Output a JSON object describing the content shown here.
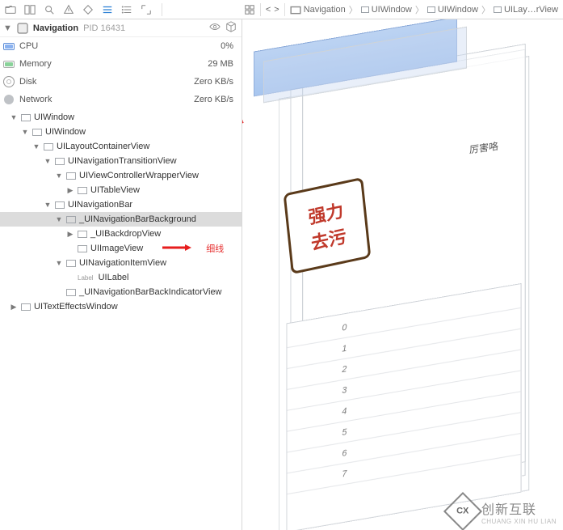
{
  "toolbar": {
    "icons": [
      "folder-icon",
      "panels-icon",
      "search-icon",
      "warning-icon",
      "diamond-icon",
      "align-icon",
      "list-icon",
      "expand-icon"
    ]
  },
  "breadcrumb": {
    "nav_back": "<",
    "nav_fwd": ">",
    "items": [
      "Navigation",
      "UIWindow",
      "UIWindow",
      "UILay…rView"
    ]
  },
  "navHeader": {
    "title": "Navigation",
    "pid_label": "PID 16431"
  },
  "stats": [
    {
      "label": "CPU",
      "value": "0%",
      "icon": "cpu"
    },
    {
      "label": "Memory",
      "value": "29 MB",
      "icon": "mem"
    },
    {
      "label": "Disk",
      "value": "Zero KB/s",
      "icon": "disk"
    },
    {
      "label": "Network",
      "value": "Zero KB/s",
      "icon": "net"
    }
  ],
  "tree": [
    {
      "d": 0,
      "o": true,
      "t": "UIWindow"
    },
    {
      "d": 1,
      "o": true,
      "t": "UIWindow"
    },
    {
      "d": 2,
      "o": true,
      "t": "UILayoutContainerView"
    },
    {
      "d": 3,
      "o": true,
      "t": "UINavigationTransitionView"
    },
    {
      "d": 4,
      "o": true,
      "t": "UIViewControllerWrapperView"
    },
    {
      "d": 5,
      "o": false,
      "t": "UITableView",
      "leaf": false
    },
    {
      "d": 3,
      "o": true,
      "t": "UINavigationBar"
    },
    {
      "d": 4,
      "o": true,
      "t": "_UINavigationBarBackground",
      "sel": true
    },
    {
      "d": 5,
      "o": false,
      "t": "_UIBackdropView",
      "leaf": false
    },
    {
      "d": 5,
      "t": "UIImageView",
      "leaf": true,
      "annot": "细线",
      "arrow": true
    },
    {
      "d": 4,
      "o": true,
      "t": "UINavigationItemView"
    },
    {
      "d": 5,
      "t": "UILabel",
      "leaf": true,
      "labeltag": true
    },
    {
      "d": 4,
      "t": "_UINavigationBarBackIndicatorView",
      "leaf": true
    },
    {
      "d": 0,
      "o": false,
      "t": "UITextEffectsWindow",
      "leaf": false
    }
  ],
  "preview": {
    "header_text": "厉害咯",
    "card_line1": "强力",
    "card_line2": "去污",
    "list_values": [
      "0",
      "1",
      "2",
      "3",
      "4",
      "5",
      "6",
      "7"
    ]
  },
  "watermark": {
    "brand": "创新互联",
    "sub": "CHUANG XIN HU LIAN",
    "logo_text": "CX"
  }
}
